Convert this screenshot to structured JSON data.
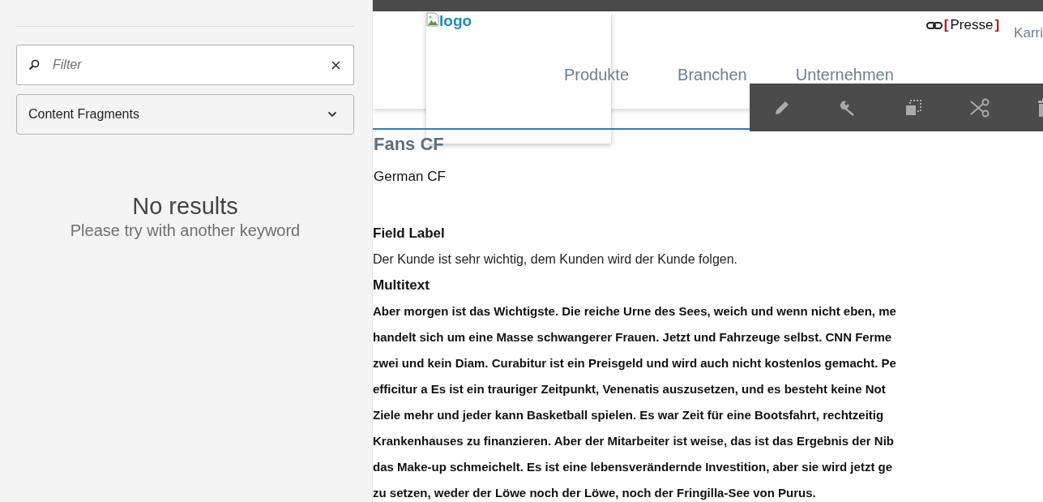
{
  "sidebar": {
    "search": {
      "placeholder": "Filter"
    },
    "dropdown": {
      "value": "Content Fragments"
    },
    "empty": {
      "title": "No results",
      "hint": "Please try with another keyword"
    }
  },
  "header": {
    "logo": "logo",
    "top_links": [
      {
        "kind": "bracketed",
        "open": "[",
        "label": "Presse",
        "close": "]"
      },
      {
        "kind": "plain",
        "label": "Karri"
      }
    ],
    "nav": [
      "Produkte",
      "Branchen",
      "Unternehmen"
    ]
  },
  "toolbar": {
    "actions": [
      {
        "kind": "edit"
      },
      {
        "kind": "configure"
      },
      {
        "kind": "copy"
      },
      {
        "kind": "cut"
      },
      {
        "kind": "delete"
      }
    ]
  },
  "content": {
    "title": "Fans CF",
    "subtitle": "German CF",
    "fields": [
      {
        "label": "Field Label",
        "lines": [
          "Der Kunde ist sehr wichtig, dem Kunden wird der Kunde folgen."
        ],
        "bold": false
      },
      {
        "label": "Multitext",
        "bold": true,
        "lines": [
          "Aber morgen ist das Wichtigste. Die reiche Urne des Sees, weich und wenn nicht eben, me",
          "handelt sich um eine Masse schwangerer Frauen. Jetzt und Fahrzeuge selbst. CNN Ferme",
          "zwei und kein Diam. Curabitur ist ein Preisgeld und wird auch nicht kostenlos gemacht. Pe",
          "efficitur a Es ist ein trauriger Zeitpunkt, Venenatis auszusetzen, und es besteht keine Not",
          "Ziele mehr und jeder kann Basketball spielen. Es war Zeit für eine Bootsfahrt, rechtzeitig",
          "Krankenhauses zu finanzieren. Aber der Mitarbeiter ist weise, das ist das Ergebnis der Nib",
          "das Make-up schmeichelt. Es ist eine lebensverändernde Investition, aber sie wird jetzt ge",
          "zu setzen, weder der Löwe noch der Löwe, noch der Fringilla-See von Purus."
        ]
      }
    ]
  }
}
